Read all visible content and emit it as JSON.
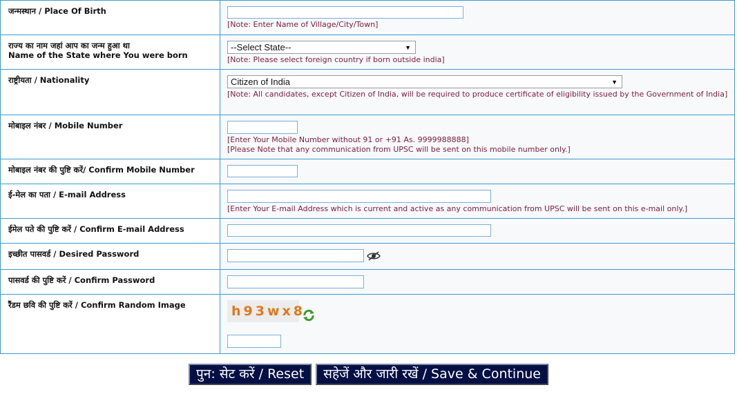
{
  "fields": {
    "place_of_birth": {
      "label": "जन्मस्थान / Place Of Birth",
      "value": "",
      "note": "[Note: Enter Name of Village/City/Town]"
    },
    "state_born": {
      "label_hi": "राज्य का नाम जहां आप का जन्म हुआ था",
      "label_en": "Name of the State where You were born",
      "selected": "--Select State--",
      "note": "[Note: Please select foreign country if born outside india]"
    },
    "nationality": {
      "label": "राष्ट्रीयता / Nationality",
      "selected": "Citizen of India",
      "note": "[Note: All candidates, except Citizen of India, will be required to produce certificate of eligibility issued by the Government of India]"
    },
    "mobile": {
      "label": "मोबाइल नंबर / Mobile Number",
      "value": "",
      "note1": "[Enter Your Mobile Number without 91 or +91 As. 9999988888]",
      "note2": "[Please Note that any communication from UPSC will be sent on this mobile number only.]"
    },
    "confirm_mobile": {
      "label": "मोबाइल नंबर की पुष्टि करें/ Confirm Mobile Number",
      "value": ""
    },
    "email": {
      "label": "ई-मेल का पता / E-mail Address",
      "value": "",
      "note": "[Enter Your E-mail Address which is current and active as any communication from UPSC will be sent on this e-mail only.]"
    },
    "confirm_email": {
      "label": "ईमेल पते की पुष्टि करें / Confirm E-mail Address",
      "value": ""
    },
    "password": {
      "label": "इच्छीत पासवर्ड / Desired Password",
      "value": "",
      "toggle_icon": "eye-slash-icon"
    },
    "confirm_password": {
      "label": "पासवर्ड की पुष्टि करें / Confirm Password",
      "value": ""
    },
    "captcha": {
      "label": "रैंडम छवि की पुष्टि करें / Confirm Random Image",
      "image_text": "h93wx8",
      "refresh_icon": "refresh-icon",
      "value": ""
    }
  },
  "buttons": {
    "reset": "पुन: सेट करें / Reset",
    "save": "सहेजें और जारी रखें / Save & Continue"
  },
  "colors": {
    "border": "#3b9bd0",
    "note_text": "#7a1b3a",
    "button_bg": "#041044",
    "captcha_text": "#e0781c"
  }
}
